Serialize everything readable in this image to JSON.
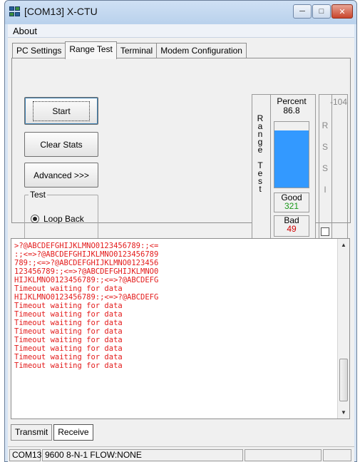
{
  "window": {
    "title": "[COM13] X-CTU",
    "icon": "xctu-app-icon",
    "buttons": {
      "minimize": "minimize-icon",
      "maximize": "maximize-icon",
      "close": "close-icon"
    }
  },
  "menu": {
    "items": [
      "About"
    ]
  },
  "tabs": [
    {
      "label": "PC Settings",
      "active": false
    },
    {
      "label": "Range Test",
      "active": true
    },
    {
      "label": "Terminal",
      "active": false
    },
    {
      "label": "Modem Configuration",
      "active": false
    }
  ],
  "range_test": {
    "start_label": "Start",
    "clear_stats_label": "Clear Stats",
    "advanced_label": "Advanced >>>",
    "test_group_label": "Test",
    "loop_back_label": "Loop Back",
    "loop_back_selected": true,
    "range_label_letters": [
      "R",
      "a",
      "n",
      "g",
      "e",
      "",
      "T",
      "e",
      "s",
      "t"
    ],
    "percent_label": "Percent",
    "percent_value": "86.8",
    "percent_fraction": 0.868,
    "bar_color": "#3399ff",
    "good_label": "Good",
    "good_value": "321",
    "good_color": "#1a9a1a",
    "bad_label": "Bad",
    "bad_value": "49",
    "bad_color": "#d00000"
  },
  "rssi": {
    "letters": [
      "R",
      "S",
      "S",
      "I"
    ],
    "value": "-104",
    "checkbox_checked": false
  },
  "terminal": {
    "text_color": "#e31b1b",
    "lines": [
      ">?@ABCDEFGHIJKLMNO0123456789:;<=",
      ":;<=>?@ABCDEFGHIJKLMNO0123456789",
      "789:;<=>?@ABCDEFGHIJKLMNO0123456",
      "123456789:;<=>?@ABCDEFGHIJKLMNO0",
      "HIJKLMNO0123456789:;<=>?@ABCDEFG",
      "Timeout waiting for data",
      "HIJKLMNO0123456789:;<=>?@ABCDEFG",
      "Timeout waiting for data",
      "Timeout waiting for data",
      "Timeout waiting for data",
      "Timeout waiting for data",
      "Timeout waiting for data",
      "Timeout waiting for data",
      "Timeout waiting for data",
      "Timeout waiting for data"
    ]
  },
  "bottom_tabs": [
    {
      "label": "Transmit",
      "active": false
    },
    {
      "label": "Receive",
      "active": true
    }
  ],
  "status": {
    "port": "COM13",
    "settings": "9600 8-N-1  FLOW:NONE"
  }
}
